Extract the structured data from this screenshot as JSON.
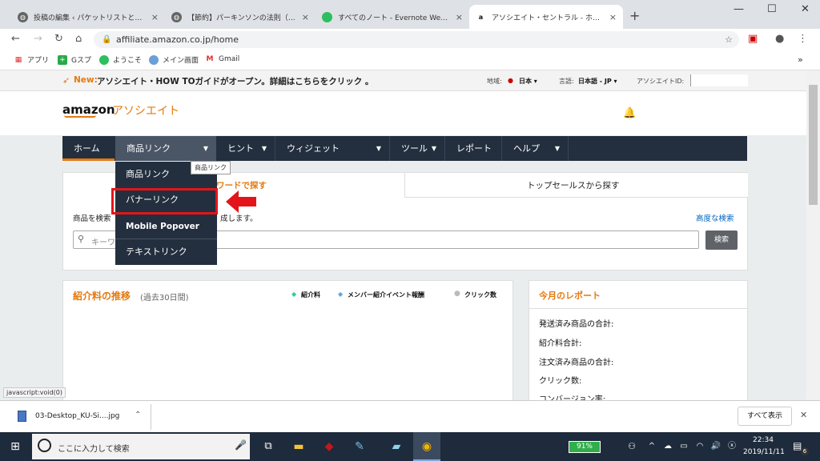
{
  "tabs": [
    {
      "title": "投稿の編集 ‹ パケットリストと経済的",
      "close": "×"
    },
    {
      "title": "【節約】パーキンソンの法則（お金編）",
      "close": "×"
    },
    {
      "title": "すべてのノート - Evernote Web 版",
      "close": "×"
    },
    {
      "title": "アソシエイト・セントラル - ホーム",
      "close": "×"
    }
  ],
  "new_tab": "+",
  "window": {
    "minimize": "—",
    "maximize": "☐",
    "close": "✕"
  },
  "address": {
    "url": "affiliate.amazon.co.jp/home"
  },
  "bookmarks": [
    "アプリ",
    "Gスプ",
    "ようこそ",
    "メイン画面",
    "Gmail"
  ],
  "bookmarks_more": "»",
  "topbar": {
    "new_badge": "New:",
    "announcement": "アソシエイト・HOW TOガイドがオープン。詳細はこちらをクリック 。",
    "region_label": "地域:",
    "region_value": "日本",
    "lang_label": "言語:",
    "lang_value": "日本語 - JP",
    "id_label": "アソシエイトID:"
  },
  "logo": {
    "amazon": "amazon",
    "assoc": "アソシエイト"
  },
  "nav": [
    "ホーム",
    "商品リンク",
    "ヒント",
    "ウィジェット",
    "ツール",
    "レポート",
    "ヘルプ"
  ],
  "dropdown": [
    "商品リンク",
    "バナーリンク",
    "Mobile Popover",
    "テキストリンク"
  ],
  "tooltip": "商品リンク",
  "search_card": {
    "tab1": "ワードで探す",
    "tab2": "トップセールスから探す",
    "desc_left": "商品を検索",
    "desc_right": "成します。",
    "advanced": "高度な検索",
    "placeholder": "キーワ",
    "button": "検索"
  },
  "report": {
    "title": "紹介料の推移",
    "subtitle": "(過去30日間)",
    "legend": [
      "紹介料",
      "メンバー紹介イベント報酬",
      "クリック数"
    ]
  },
  "monthly": {
    "title": "今月のレポート",
    "rows": [
      "発送済み商品の合計:",
      "紹介料合計:",
      "注文済み商品の合計:",
      "クリック数:",
      "コンバージョン率:"
    ]
  },
  "status_url": "javascript:void(0)",
  "download": {
    "file": "03-Desktop_KU-Si....jpg",
    "show_all": "すべて表示"
  },
  "taskbar": {
    "search": "ここに入力して検索",
    "battery": "91%",
    "time": "22:34",
    "date": "2019/11/11",
    "notif": "6"
  },
  "colors": {
    "orange": "#e47911",
    "nav": "#232f3e",
    "red": "#e3151a"
  }
}
